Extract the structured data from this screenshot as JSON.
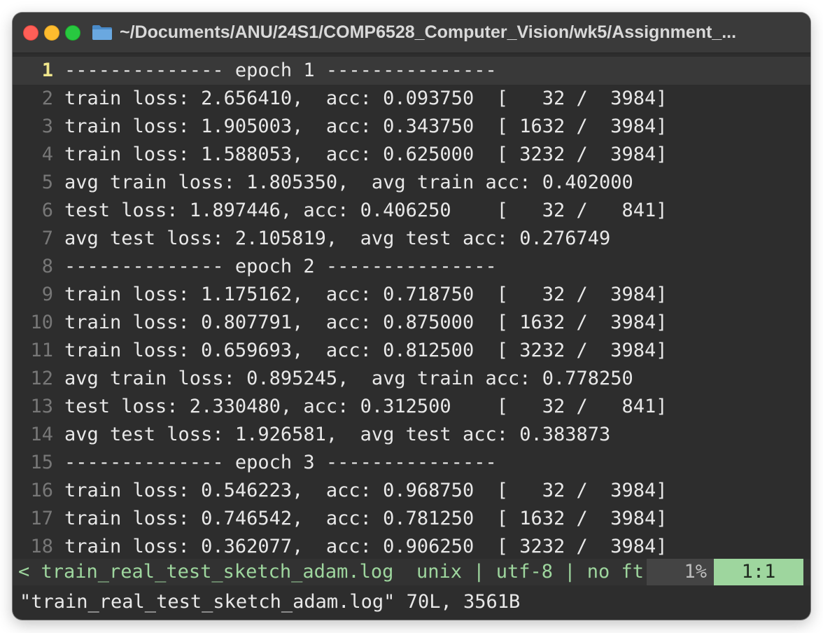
{
  "window": {
    "title": "~/Documents/ANU/24S1/COMP6528_Computer_Vision/wk5/Assignment_...",
    "colors": {
      "close": "#ff5f57",
      "minimize": "#febc2e",
      "zoom": "#28c840",
      "folder": "#5b9bd5"
    }
  },
  "editor": {
    "lines": [
      {
        "num": "1",
        "text": "-------------- epoch 1 ---------------"
      },
      {
        "num": "2",
        "text": "train loss: 2.656410,  acc: 0.093750  [   32 /  3984]"
      },
      {
        "num": "3",
        "text": "train loss: 1.905003,  acc: 0.343750  [ 1632 /  3984]"
      },
      {
        "num": "4",
        "text": "train loss: 1.588053,  acc: 0.625000  [ 3232 /  3984]"
      },
      {
        "num": "5",
        "text": "avg train loss: 1.805350,  avg train acc: 0.402000"
      },
      {
        "num": "6",
        "text": "test loss: 1.897446, acc: 0.406250    [   32 /   841]"
      },
      {
        "num": "7",
        "text": "avg test loss: 2.105819,  avg test acc: 0.276749"
      },
      {
        "num": "8",
        "text": "-------------- epoch 2 ---------------"
      },
      {
        "num": "9",
        "text": "train loss: 1.175162,  acc: 0.718750  [   32 /  3984]"
      },
      {
        "num": "10",
        "text": "train loss: 0.807791,  acc: 0.875000  [ 1632 /  3984]"
      },
      {
        "num": "11",
        "text": "train loss: 0.659693,  acc: 0.812500  [ 3232 /  3984]"
      },
      {
        "num": "12",
        "text": "avg train loss: 0.895245,  avg train acc: 0.778250"
      },
      {
        "num": "13",
        "text": "test loss: 2.330480, acc: 0.312500    [   32 /   841]"
      },
      {
        "num": "14",
        "text": "avg test loss: 1.926581,  avg test acc: 0.383873"
      },
      {
        "num": "15",
        "text": "-------------- epoch 3 ---------------"
      },
      {
        "num": "16",
        "text": "train loss: 0.546223,  acc: 0.968750  [   32 /  3984]"
      },
      {
        "num": "17",
        "text": "train loss: 0.746542,  acc: 0.781250  [ 1632 /  3984]"
      },
      {
        "num": "18",
        "text": "train loss: 0.362077,  acc: 0.906250  [ 3232 /  3984]"
      }
    ]
  },
  "statusline": {
    "left": "< train_real_test_sketch_adam.log  unix | utf-8 | no ft",
    "percent": "1%",
    "position": "1:1"
  },
  "cmdline": "\"train_real_test_sketch_adam.log\" 70L, 3561B"
}
